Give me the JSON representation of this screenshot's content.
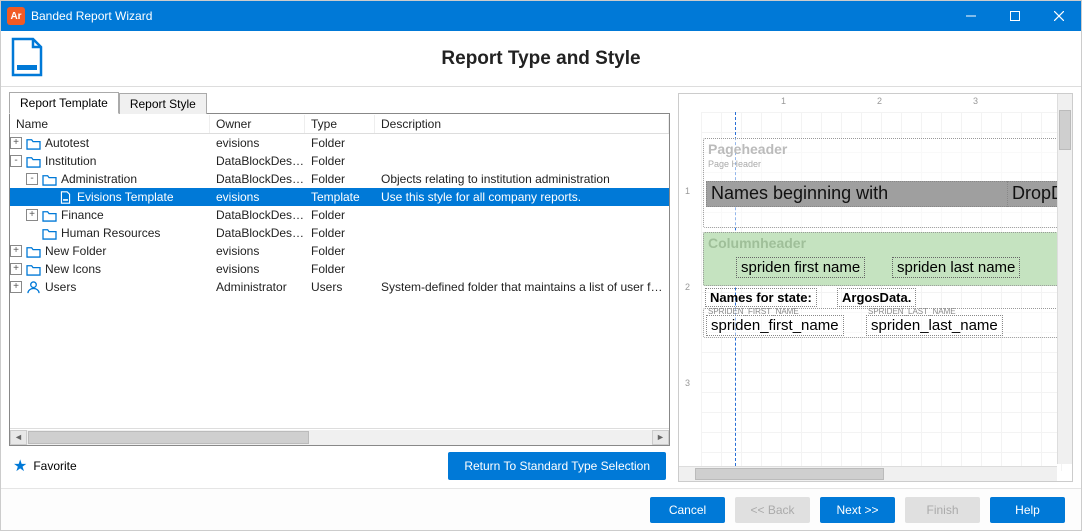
{
  "titlebar": {
    "app_icon_label": "Ar",
    "title": "Banded Report Wizard"
  },
  "header": {
    "title": "Report Type and Style"
  },
  "tabs": {
    "template": "Report Template",
    "style": "Report Style"
  },
  "columns": {
    "name": "Name",
    "owner": "Owner",
    "type": "Type",
    "desc": "Description"
  },
  "tree": [
    {
      "indent": 0,
      "expander": "+",
      "icon": "folder",
      "name": "Autotest",
      "owner": "evisions",
      "type": "Folder",
      "desc": "",
      "selected": false
    },
    {
      "indent": 0,
      "expander": "-",
      "icon": "folder",
      "name": "Institution",
      "owner": "DataBlockDesig...",
      "type": "Folder",
      "desc": "",
      "selected": false
    },
    {
      "indent": 1,
      "expander": "-",
      "icon": "folder",
      "name": "Administration",
      "owner": "DataBlockDesig...",
      "type": "Folder",
      "desc": "Objects relating to institution administration",
      "selected": false
    },
    {
      "indent": 2,
      "expander": " ",
      "icon": "template",
      "name": "Evisions Template",
      "owner": "evisions",
      "type": "Template",
      "desc": "Use this style for all company reports.",
      "selected": true
    },
    {
      "indent": 1,
      "expander": "+",
      "icon": "folder",
      "name": "Finance",
      "owner": "DataBlockDesig...",
      "type": "Folder",
      "desc": "",
      "selected": false
    },
    {
      "indent": 1,
      "expander": " ",
      "icon": "folder",
      "name": "Human Resources",
      "owner": "DataBlockDesig...",
      "type": "Folder",
      "desc": "",
      "selected": false
    },
    {
      "indent": 0,
      "expander": "+",
      "icon": "folder",
      "name": "New Folder",
      "owner": "evisions",
      "type": "Folder",
      "desc": "",
      "selected": false
    },
    {
      "indent": 0,
      "expander": "+",
      "icon": "folder",
      "name": "New Icons",
      "owner": "evisions",
      "type": "Folder",
      "desc": "",
      "selected": false
    },
    {
      "indent": 0,
      "expander": "+",
      "icon": "users",
      "name": "Users",
      "owner": "Administrator",
      "type": "Users",
      "desc": "System-defined folder that maintains a list of user folders",
      "selected": false
    }
  ],
  "favorite": {
    "label": "Favorite"
  },
  "return_btn": "Return To Standard Type Selection",
  "preview": {
    "ruler_h": [
      "1",
      "2",
      "3"
    ],
    "ruler_v": [
      "1",
      "2",
      "3"
    ],
    "pageheader_label": "Pageheader",
    "pageheader_sub": "Page Header",
    "names_begin": "Names beginning with",
    "dropd": "DropD",
    "columnheader_label": "Columnheader",
    "col1": "spriden first name",
    "col2": "spriden last name",
    "names_state": "Names for state:",
    "argos": "ArgosData.",
    "sf_upper": "SPRIDEN_FIRST_NAME",
    "sl_upper": "SPRIDEN_LAST_NAME",
    "sf": "spriden_first_name",
    "sl": "spriden_last_name"
  },
  "footer": {
    "cancel": "Cancel",
    "back": "<< Back",
    "next": "Next >>",
    "finish": "Finish",
    "help": "Help"
  }
}
